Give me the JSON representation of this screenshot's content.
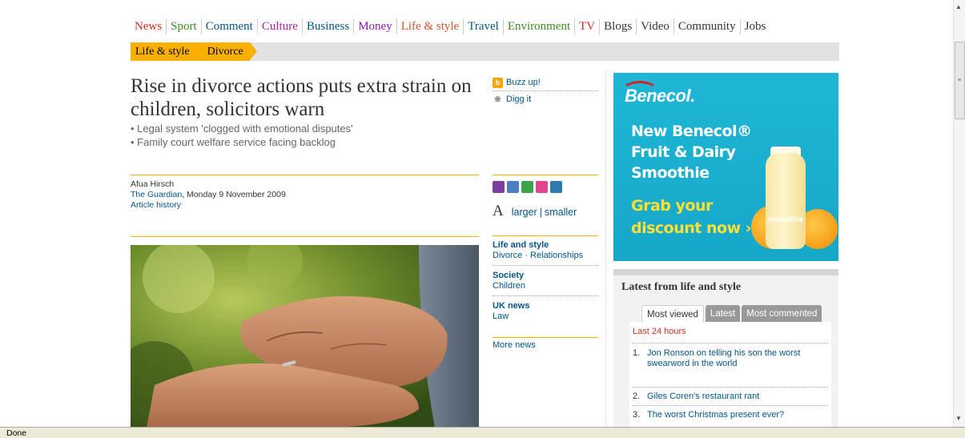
{
  "nav": [
    {
      "label": "News",
      "color": "#d52b1e"
    },
    {
      "label": "Sport",
      "color": "#3d8b1f"
    },
    {
      "label": "Comment",
      "color": "#005689"
    },
    {
      "label": "Culture",
      "color": "#b51ba3"
    },
    {
      "label": "Business",
      "color": "#005689"
    },
    {
      "label": "Money",
      "color": "#8f1ab6"
    },
    {
      "label": "Life & style",
      "color": "#d9522a"
    },
    {
      "label": "Travel",
      "color": "#005689"
    },
    {
      "label": "Environment",
      "color": "#3d8b1f"
    },
    {
      "label": "TV",
      "color": "#d52b1e"
    },
    {
      "label": "Blogs",
      "color": "#333333"
    },
    {
      "label": "Video",
      "color": "#333333"
    },
    {
      "label": "Community",
      "color": "#333333"
    },
    {
      "label": "Jobs",
      "color": "#333333"
    }
  ],
  "breadcrumb": {
    "section": "Life & style",
    "subsection": "Divorce",
    "color": "#f9b000"
  },
  "article": {
    "headline": "Rise in divorce actions puts extra strain on children, solicitors warn",
    "standfirst": [
      "• Legal system 'clogged with emotional disputes'",
      "• Family court welfare service facing backlog"
    ],
    "author": "Afua Hirsch",
    "publication": "The Guardian",
    "date": ", Monday 9 November 2009",
    "history_link": "Article history"
  },
  "share": {
    "buzz": {
      "label": "Buzz up!",
      "icon": "yahoo-buzz-icon"
    },
    "digg": {
      "label": "Digg it",
      "icon": "digg-icon"
    },
    "tools": [
      {
        "icon": "print-icon",
        "color": "#7b3fa0"
      },
      {
        "icon": "email-icon",
        "color": "#4a7fc1"
      },
      {
        "icon": "share-icon",
        "color": "#3aa54a"
      },
      {
        "icon": "clip-icon",
        "color": "#e0458f"
      },
      {
        "icon": "save-icon",
        "color": "#2d7ab0"
      }
    ],
    "font_big": "A",
    "larger": "larger",
    "sep": "|",
    "smaller": "smaller"
  },
  "tags": [
    {
      "head": "Life and style",
      "links": "Divorce · Relationships"
    },
    {
      "head": "Society",
      "links": "Children"
    },
    {
      "head": "UK news",
      "links": "Law"
    }
  ],
  "more_news": "More news",
  "ad": {
    "brand": "Benecol.",
    "lines": [
      "New Benecol®",
      "Fruit & Dairy",
      "Smoothie"
    ],
    "cta": [
      "Grab your",
      "discount now ›"
    ],
    "bottle_label": "smoothie"
  },
  "latest": {
    "title": "Latest from life and style",
    "tabs": [
      "Most viewed",
      "Latest",
      "Most commented"
    ],
    "period": "Last 24 hours",
    "items": [
      {
        "num": "1.",
        "text": "Jon Ronson on telling his son the worst swearword in the world"
      },
      {
        "num": "2.",
        "text": "Giles Coren's restaurant rant"
      },
      {
        "num": "3.",
        "text": "The worst Christmas present ever?"
      }
    ]
  },
  "status": "Done"
}
